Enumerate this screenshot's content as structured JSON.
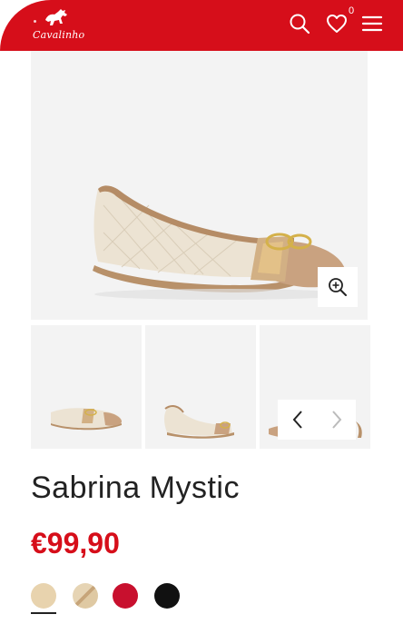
{
  "header": {
    "brand": "Cavalinho",
    "wishlist_count": "0",
    "background": "#d60e1a"
  },
  "product": {
    "name": "Sabrina Mystic",
    "price": "€99,90",
    "price_color": "#d60e1a"
  },
  "gallery": {
    "thumbnail_count": 3,
    "zoom_icon": "zoom-in-icon",
    "prev_icon": "chevron-left-icon",
    "next_icon": "chevron-right-icon"
  },
  "swatches": [
    {
      "color": "#e8d3ae",
      "selected": true
    },
    {
      "color": "#dfc9a3",
      "accent": "#c7a57a",
      "selected": false
    },
    {
      "color": "#c8102e",
      "selected": false
    },
    {
      "color": "#111111",
      "selected": false
    }
  ]
}
